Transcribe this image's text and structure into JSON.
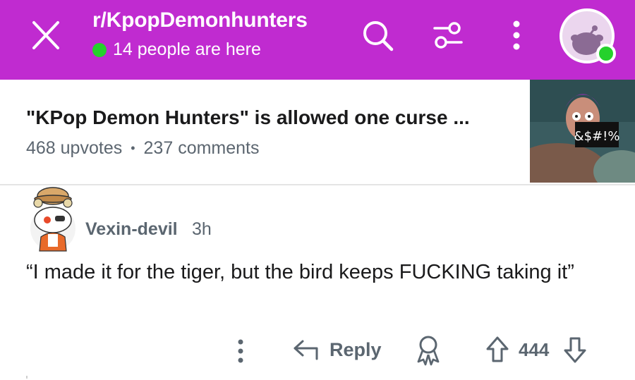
{
  "header": {
    "subreddit": "r/KpopDemonhunters",
    "online_text": "14 people are here",
    "background_color": "#c02bd0",
    "online_color": "#25d12c",
    "icons": [
      "close-icon",
      "search-icon",
      "filter-icon",
      "more-icon",
      "user-avatar"
    ]
  },
  "post": {
    "title": "\"KPop Demon Hunters\" is allowed one curse ...",
    "upvotes": "468 upvotes",
    "separator": "•",
    "comments": "237 comments",
    "thumbnail_caption": "&$#!%"
  },
  "comment": {
    "author": "Vexin-devil",
    "time": "3h",
    "body": "“I made it for the tiger, but the bird keeps FUCKING taking it”",
    "actions": {
      "reply_label": "Reply",
      "score": "444"
    }
  }
}
